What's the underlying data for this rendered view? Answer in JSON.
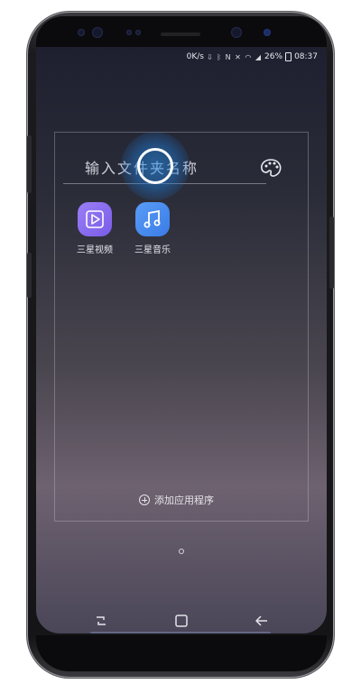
{
  "status_bar": {
    "net_speed": "0K/s",
    "battery": "26%",
    "time": "08:37",
    "icons": [
      "download-icon",
      "bluetooth-icon",
      "nfc-icon",
      "mute-icon",
      "wifi-icon",
      "signal-icon",
      "battery-icon"
    ]
  },
  "folder": {
    "name_placeholder": "输入文件夹名称",
    "palette_icon": "palette-icon",
    "apps": [
      {
        "label": "三星视频",
        "icon": "video-play-icon",
        "color": "#8a6cf0"
      },
      {
        "label": "三星音乐",
        "icon": "music-note-icon",
        "color": "#4a8cf0"
      }
    ],
    "add_apps_label": "添加应用程序"
  },
  "nav": {
    "recents": "recents-icon",
    "home": "home-icon",
    "back": "back-icon"
  },
  "colors": {
    "ripple": "#2a8ce8",
    "text": "#e6e6ee"
  }
}
